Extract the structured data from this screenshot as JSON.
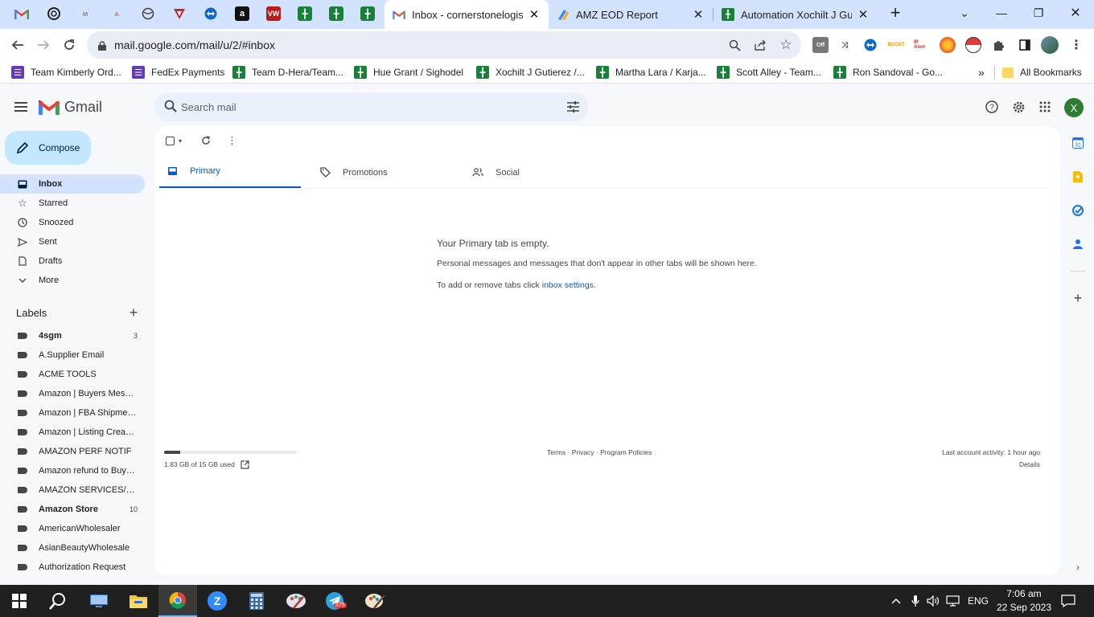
{
  "browser": {
    "pinned_tabs": [
      {
        "icon": "gmail-icon"
      },
      {
        "icon": "chatgpt-icon"
      },
      {
        "icon": "generic-site-icon"
      },
      {
        "icon": "generic-site-icon"
      },
      {
        "icon": "globe-icon"
      },
      {
        "icon": "vpn-icon"
      },
      {
        "icon": "teamviewer-icon"
      },
      {
        "icon": "amazon-icon"
      },
      {
        "icon": "vw-icon",
        "text": "VW"
      },
      {
        "icon": "sheets-icon"
      },
      {
        "icon": "sheets-icon"
      },
      {
        "icon": "sheets-icon"
      }
    ],
    "tabs": [
      {
        "title": "Inbox - cornerstonelogistic",
        "icon": "gmail-icon",
        "active": true
      },
      {
        "title": "AMZ EOD Report",
        "icon": "looker-icon",
        "active": false
      },
      {
        "title": "Automation Xochilt J Gutie",
        "icon": "sheets-icon",
        "active": false
      }
    ],
    "new_tab_label": "+",
    "url": "mail.google.com/mail/u/2/#inbox",
    "extensions": [
      {
        "name": "ext-off",
        "badge": "Off"
      },
      {
        "name": "ext-ll"
      },
      {
        "name": "ext-teamviewer"
      },
      {
        "name": "ext-boost",
        "badge": "BOOST"
      },
      {
        "name": "ext-ip-alert",
        "badge": "IP Alert"
      },
      {
        "name": "ext-firefox"
      },
      {
        "name": "ext-pokeball"
      }
    ],
    "bookmarks": [
      {
        "label": "Team Kimberly Ord...",
        "icon": "forms-icon",
        "color": "#673ab7"
      },
      {
        "label": "FedEx Payments",
        "icon": "forms-icon",
        "color": "#673ab7"
      },
      {
        "label": "Team D-Hera/Team...",
        "icon": "sheets-icon",
        "color": "#188038"
      },
      {
        "label": "Hue Grant / Sighodel",
        "icon": "sheets-icon",
        "color": "#188038"
      },
      {
        "label": "Xochilt J Gutierez /...",
        "icon": "sheets-icon",
        "color": "#188038"
      },
      {
        "label": "Martha Lara / Karja...",
        "icon": "sheets-icon",
        "color": "#188038"
      },
      {
        "label": "Scott Alley - Team...",
        "icon": "sheets-icon",
        "color": "#188038"
      },
      {
        "label": "Ron Sandoval - Go...",
        "icon": "sheets-icon",
        "color": "#188038"
      }
    ],
    "more_bookmarks": "»",
    "all_bookmarks": "All Bookmarks"
  },
  "gmail": {
    "app_name": "Gmail",
    "search_placeholder": "Search mail",
    "avatar_letter": "X",
    "compose_label": "Compose",
    "nav": [
      {
        "label": "Inbox",
        "icon": "inbox-icon",
        "active": true
      },
      {
        "label": "Starred",
        "icon": "star-icon"
      },
      {
        "label": "Snoozed",
        "icon": "clock-icon"
      },
      {
        "label": "Sent",
        "icon": "send-icon"
      },
      {
        "label": "Drafts",
        "icon": "draft-icon"
      },
      {
        "label": "More",
        "icon": "chevron-down-icon"
      }
    ],
    "labels_heading": "Labels",
    "labels": [
      {
        "label": "4sgm",
        "count": "3",
        "bold": true
      },
      {
        "label": "A.Supplier Email",
        "count": ""
      },
      {
        "label": "ACME TOOLS",
        "count": ""
      },
      {
        "label": "Amazon | Buyers Messa...",
        "count": ""
      },
      {
        "label": "Amazon | FBA Shipments",
        "count": ""
      },
      {
        "label": "Amazon | Listing Created",
        "count": ""
      },
      {
        "label": "AMAZON PERF NOTIF",
        "count": ""
      },
      {
        "label": "Amazon refund to Buyers",
        "count": ""
      },
      {
        "label": "AMAZON SERVICES/PAY...",
        "count": ""
      },
      {
        "label": "Amazon Store",
        "count": "10",
        "bold": true
      },
      {
        "label": "AmericanWholesaler",
        "count": ""
      },
      {
        "label": "AsianBeautyWholesale",
        "count": ""
      },
      {
        "label": "Authorization Request",
        "count": ""
      }
    ],
    "inbox_tabs": [
      {
        "label": "Primary",
        "icon": "inbox-icon",
        "active": true
      },
      {
        "label": "Promotions",
        "icon": "tag-icon"
      },
      {
        "label": "Social",
        "icon": "people-icon"
      }
    ],
    "empty_title": "Your Primary tab is empty.",
    "empty_desc": "Personal messages and messages that don't appear in other tabs will be shown here.",
    "empty_tip_prefix": "To add or remove tabs click ",
    "empty_tip_link": "inbox settings",
    "empty_tip_suffix": ".",
    "storage": {
      "text": "1.83 GB of 15 GB used",
      "used_fraction": 0.122
    },
    "footer_links": "Terms · Privacy · Program Policies",
    "last_activity": "Last account activity: 1 hour ago",
    "details_link": "Details"
  },
  "taskbar": {
    "apps": [
      {
        "name": "file-explorer-icon"
      },
      {
        "name": "chrome-icon",
        "active": true
      },
      {
        "name": "zoom-icon"
      },
      {
        "name": "calculator-icon"
      },
      {
        "name": "paint-icon"
      },
      {
        "name": "telegram-icon",
        "badge": "575"
      },
      {
        "name": "paint-3d-icon"
      }
    ],
    "language": "ENG",
    "time": "7:06 am",
    "date": "22 Sep 2023"
  }
}
